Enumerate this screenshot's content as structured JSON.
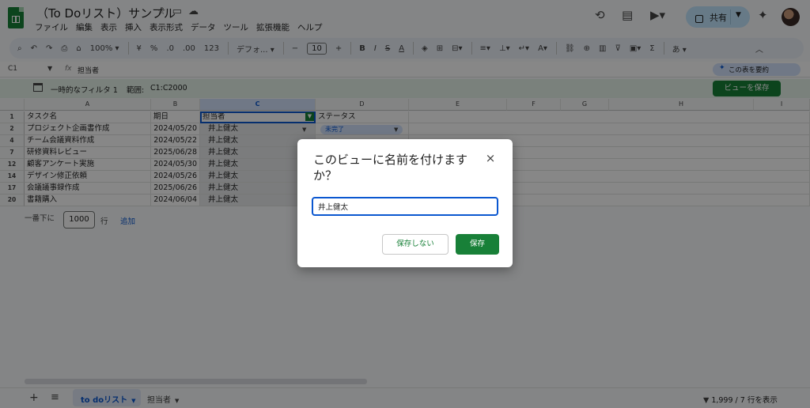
{
  "app": {
    "doc_title": "（To Doリスト）サンプル",
    "menu": [
      "ファイル",
      "編集",
      "表示",
      "挿入",
      "表示形式",
      "データ",
      "ツール",
      "拡張機能",
      "ヘルプ"
    ],
    "share_label": "共有"
  },
  "toolbar": {
    "zoom": "100%",
    "yen": "¥",
    "percent": "%",
    "dec_less": ".0",
    "dec_more": ".00",
    "num123": "123",
    "font": "デフォ...",
    "font_size": "10",
    "bold": "B",
    "italic": "I",
    "strike": "S",
    "textcolor": "A",
    "input_tool": "あ"
  },
  "formula_bar": {
    "cell_ref": "C1",
    "fx": "fx",
    "value": "担当者",
    "summarize_label": "この表を要約"
  },
  "filter_bar": {
    "name": "一時的なフィルタ 1",
    "range_label": "範囲:",
    "range_value": "C1:C2000",
    "save_view_label": "ビューを保存"
  },
  "sheet": {
    "columns": [
      "A",
      "B",
      "C",
      "D",
      "E",
      "F",
      "G",
      "H",
      "I"
    ],
    "headers": [
      "タスク名",
      "期日",
      "担当者",
      "ステータス"
    ],
    "rows": [
      {
        "num": "2",
        "task": "プロジェクト企画書作成",
        "date": "2024/05/20",
        "assignee": "井上健太",
        "status": "未完了"
      },
      {
        "num": "4",
        "task": "チーム会議資料作成",
        "date": "2024/05/22",
        "assignee": "井上健太",
        "status": ""
      },
      {
        "num": "7",
        "task": "研修資料レビュー",
        "date": "2025/06/28",
        "assignee": "井上健太",
        "status": ""
      },
      {
        "num": "12",
        "task": "顧客アンケート実施",
        "date": "2024/05/30",
        "assignee": "井上健太",
        "status": ""
      },
      {
        "num": "14",
        "task": "デザイン修正依頼",
        "date": "2024/05/26",
        "assignee": "井上健太",
        "status": ""
      },
      {
        "num": "17",
        "task": "会議議事録作成",
        "date": "2025/06/26",
        "assignee": "井上健太",
        "status": ""
      },
      {
        "num": "20",
        "task": "書籍購入",
        "date": "2024/06/04",
        "assignee": "井上健太",
        "status": ""
      }
    ],
    "header_row_num": "1",
    "add_rows": {
      "prefix": "一番下に",
      "count": "1000",
      "unit": "行",
      "link": "追加"
    }
  },
  "bottom": {
    "tabs": [
      "to doリスト",
      "担当者"
    ],
    "row_count": "1,999 / 7 行を表示"
  },
  "dialog": {
    "title": "このビューに名前を付けますか？",
    "input_value": "井上健太",
    "cancel_label": "保存しない",
    "save_label": "保存"
  },
  "colors": {
    "brand_green": "#188038",
    "accent_blue": "#0b57d0",
    "share_bg": "#c2e7ff",
    "filter_bar_bg": "#e6f4ea"
  }
}
